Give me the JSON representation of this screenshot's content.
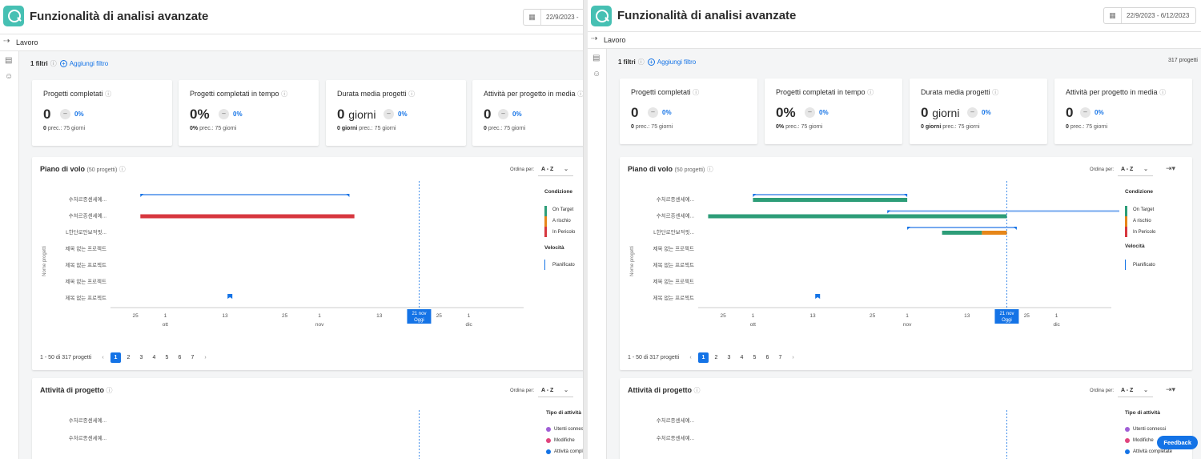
{
  "app": {
    "title": "Funzionalità di analisi avanzate",
    "breadcrumb": "Lavoro",
    "feedback": "Feedback"
  },
  "panels": [
    {
      "date_range": "22/9/2023 - ",
      "filters": {
        "count_label": "1 filtri",
        "add_label": "Aggiungi filtro"
      },
      "project_count": "",
      "today_index": 0
    },
    {
      "date_range": "22/9/2023 - 6/12/2023",
      "filters": {
        "count_label": "1 filtri",
        "add_label": "Aggiungi filtro"
      },
      "project_count": "317 progetti",
      "today_index": 1
    }
  ],
  "kpis": [
    {
      "title": "Progetti completati",
      "value": "0",
      "unit": "",
      "change": "0%",
      "prev_value": "0",
      "prev_label": "prec.: 75 giorni"
    },
    {
      "title": "Progetti completati in tempo",
      "value": "0%",
      "unit": "",
      "change": "0%",
      "prev_value": "0%",
      "prev_label": "prec.: 75 giorni"
    },
    {
      "title": "Durata media progetti",
      "value": "0",
      "unit": "giorni",
      "change": "0%",
      "prev_value": "0 giorni",
      "prev_label": "prec.: 75 giorni"
    },
    {
      "title": "Attività per progetto in media",
      "value": "0",
      "unit": "",
      "change": "0%",
      "prev_value": "0",
      "prev_label": "prec.: 75 giorni"
    }
  ],
  "flight": {
    "title": "Piano di volo",
    "subtitle": "(50 progetti)",
    "sort_label": "Ordina per:",
    "sort_value": "A - Z",
    "y_axis_label": "Nome progetti",
    "projects": [
      "수처르종센세예...",
      "수처르종센세예...",
      "L한단로안보적핏...",
      "제목 없는 프로젝트",
      "제목 없는 프로젝트",
      "제목 없는 프로젝트",
      "제목 없는 프로젝트"
    ],
    "ticks": [
      "25",
      "1",
      "13",
      "25",
      "1",
      "13",
      "25",
      "1"
    ],
    "months": [
      "ott",
      "nov",
      "dic"
    ],
    "today_date": "21 nov",
    "today_label": "Oggi",
    "legend": {
      "condition_title": "Condizione",
      "conditions": [
        {
          "label": "On Target",
          "color": "#2d9d78"
        },
        {
          "label": "A rischio",
          "color": "#e68619"
        },
        {
          "label": "In Pericolo",
          "color": "#d7373f"
        }
      ],
      "velocity_title": "Velocità",
      "velocity": "Pianificato"
    },
    "pagination": {
      "range": "1 - 50 di 317 progetti",
      "pages": [
        "1",
        "2",
        "3",
        "4",
        "5",
        "6",
        "7"
      ],
      "prev": "‹",
      "next": "›"
    }
  },
  "activity": {
    "title": "Attività di progetto",
    "sort_label": "Ordina per:",
    "sort_value": "A - Z",
    "projects": [
      "수처르종센세예...",
      "수처르종센세예..."
    ],
    "legend_title": "Tipo di attività",
    "types": [
      {
        "label": "Utenti connessi",
        "color": "#a05fd6"
      },
      {
        "label": "Modifiche",
        "color": "#e0447d"
      },
      {
        "label": "Attività completate",
        "color": "#1473e6"
      }
    ]
  },
  "chart_data": [
    {
      "type": "gantt",
      "title": "Piano di volo",
      "x_unit": "date",
      "series": [
        {
          "project": 0,
          "planned": [
            "2023-09-26",
            "2023-11-07"
          ],
          "actual": null
        },
        {
          "project": 1,
          "planned": null,
          "actual": [
            "2023-09-26",
            "2023-11-08"
          ],
          "condition": "In Pericolo"
        },
        {
          "project": 6,
          "marker": "2023-10-14"
        }
      ],
      "today": "2023-11-21"
    },
    {
      "type": "gantt",
      "title": "Piano di volo",
      "x_unit": "date",
      "series": [
        {
          "project": 0,
          "planned": [
            "2023-10-01",
            "2023-11-01"
          ],
          "actual": [
            "2023-10-01",
            "2023-11-01"
          ],
          "condition": "On Target"
        },
        {
          "project": 1,
          "planned": [
            "2023-10-28",
            "2023-12-15"
          ],
          "actual": [
            "2023-09-22",
            "2023-11-21"
          ],
          "condition": "On Target"
        },
        {
          "project": 2,
          "planned": [
            "2023-11-01",
            "2023-11-23"
          ],
          "actual": [
            [
              "2023-11-08",
              "2023-11-16",
              "On Target"
            ],
            [
              "2023-11-16",
              "2023-11-21",
              "A rischio"
            ]
          ]
        },
        {
          "project": 6,
          "marker": "2023-10-14"
        }
      ],
      "today": "2023-11-21"
    }
  ]
}
